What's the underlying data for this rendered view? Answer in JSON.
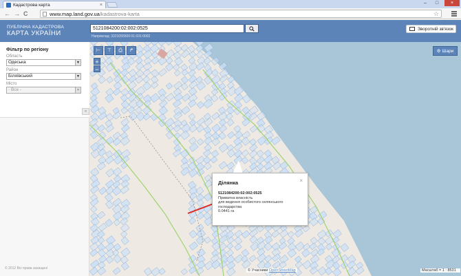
{
  "browser": {
    "tab_title": "Кадастрова карта",
    "tab_close": "×",
    "url_host": "www.map.land.gov.ua",
    "url_path": "/kadastrova-karta",
    "back": "←",
    "forward": "→",
    "reload": "C",
    "star": "☆",
    "minimize": "–",
    "maximize": "□",
    "close": "×"
  },
  "header": {
    "title_line1": "ПУБЛІЧНА КАДАСТРОВА",
    "title_line2": "КАРТА УКРАЇНИ",
    "search_value": "5121084200:02:002:0525",
    "search_hint": "Наприклад: 3221055500:01:031:0002",
    "feedback_label": "Зворотній зв'язок"
  },
  "sidebar": {
    "filter_title": "Фільтр по регіону",
    "region_label": "Область",
    "region_value": "Одеська",
    "district_label": "Район",
    "district_value": "Біляївський",
    "city_label": "Місто",
    "city_value": "- Все -",
    "collapse": "«",
    "copyright": "© 2012 Всі права захищені"
  },
  "map": {
    "zoom_in": "+",
    "zoom_out": "−",
    "layers_label": "Шари",
    "attribution_prefix": "© Учасники",
    "attribution_link": "OpenStreetMap",
    "scale_label": "Масштаб = 1 : 8531",
    "colors": {
      "land": "#eeeae3",
      "water": "#a9c5d8",
      "parcel_fill": "#cfe0f3",
      "parcel_stroke": "#7aa6d6",
      "road": "#9fd36f"
    }
  },
  "popup": {
    "title": "Ділянка",
    "close": "×",
    "cadastral_number": "5121084200:02:002:0525",
    "ownership": "Приватна власність",
    "purpose_line1": "для ведення особистого селянського",
    "purpose_line2": "господарства",
    "area": "0.0441 га"
  }
}
